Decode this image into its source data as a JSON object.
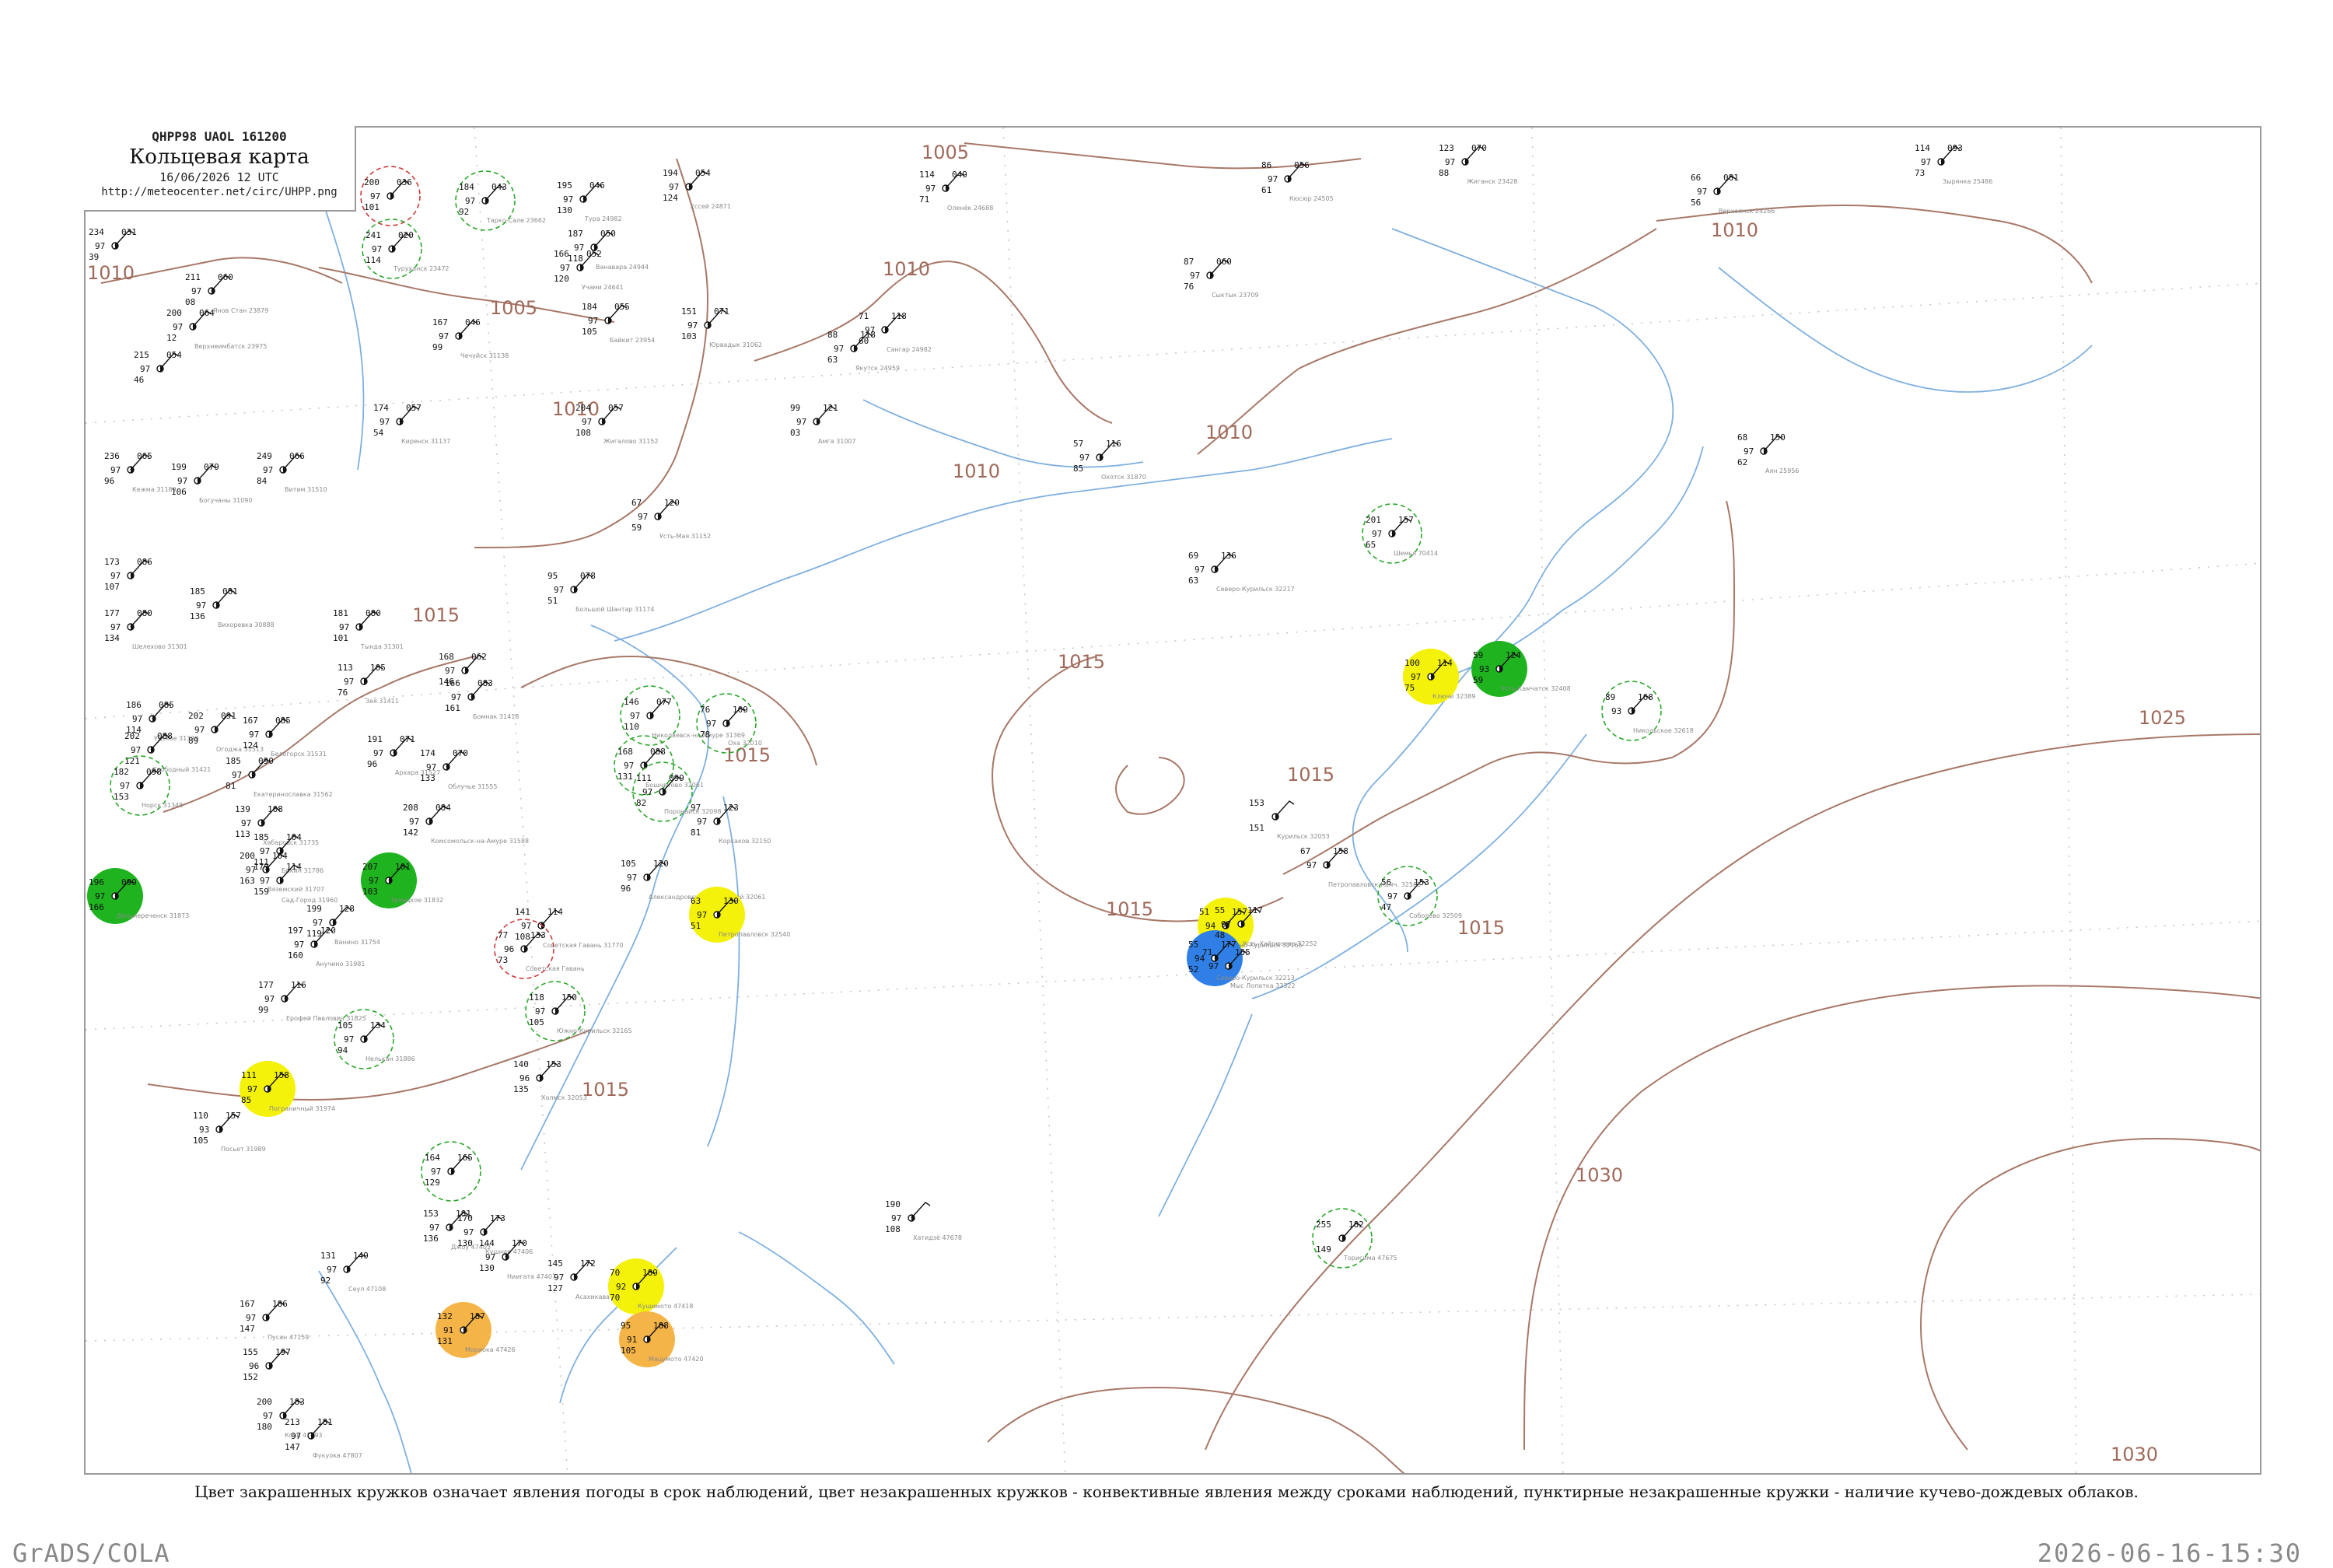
{
  "header": {
    "code_line": "QHPP98  UAOL  161200",
    "title": "Кольцевая карта",
    "date_line": "16/06/2026 12 UTC",
    "url": "http://meteocenter.net/circ/UHPP.png"
  },
  "legend_note": "Цвет закрашенных кружков означает явления погоды в срок наблюдений, цвет незакрашенных кружков - конвективные явления между сроками наблюдений, пунктирные незакрашенные кружки - наличие кучево-дождевых облаков.",
  "footer": {
    "left": "GrADS/COLA",
    "right": "2026-06-16-15:30"
  },
  "colors": {
    "isobar": "#a87868",
    "coast": "#7fb0e0",
    "grid": "#bdbdbd",
    "station": "#111111",
    "green_fill": "#1fb31f",
    "yellow_fill": "#f4f20a",
    "blue_fill": "#2f7fe6",
    "orange_fill": "#f5b447",
    "green_ring": "#2aa82a",
    "red_ring": "#cc3a3a"
  },
  "isobar_labels": [
    {
      "text": "1005"
    },
    {
      "text": "1005"
    },
    {
      "text": "1010"
    },
    {
      "text": "1010"
    },
    {
      "text": "1010"
    },
    {
      "text": "1010"
    },
    {
      "text": "1010"
    },
    {
      "text": "1010"
    },
    {
      "text": "1015"
    },
    {
      "text": "1015"
    },
    {
      "text": "1015"
    },
    {
      "text": "1015"
    },
    {
      "text": "1015"
    },
    {
      "text": "1015"
    },
    {
      "text": "1015"
    },
    {
      "text": "1025"
    },
    {
      "text": "1030"
    },
    {
      "text": "1030"
    }
  ],
  "stations": [
    {
      "t": "200",
      "p": "036",
      "d": "97",
      "w": "101",
      "name": ""
    },
    {
      "t": "241",
      "p": "020",
      "d": "97",
      "w": "114",
      "name": "Туруханск 23472"
    },
    {
      "t": "184",
      "p": "043",
      "d": "97",
      "w": "92",
      "name": "Тарко-Сале 23662"
    },
    {
      "t": "195",
      "p": "046",
      "d": "97",
      "w": "130",
      "name": "Тура 24982"
    },
    {
      "t": "194",
      "p": "054",
      "d": "97",
      "w": "124",
      "name": "Ессей 24871"
    },
    {
      "t": "211",
      "p": "060",
      "d": "97",
      "w": "08",
      "name": "Янов Стан 23879"
    },
    {
      "t": "200",
      "p": "064",
      "d": "97",
      "w": "12",
      "name": "Верхнеимбатск 23975"
    },
    {
      "t": "215",
      "p": "054",
      "d": "97",
      "w": "46",
      "name": ""
    },
    {
      "t": "234",
      "p": "031",
      "d": "97",
      "w": "39",
      "name": ""
    },
    {
      "t": "187",
      "p": "050",
      "d": "97",
      "w": "118",
      "name": "Ванавара 24944"
    },
    {
      "t": "166",
      "p": "052",
      "d": "97",
      "w": "120",
      "name": "Учами 24641"
    },
    {
      "t": "184",
      "p": "055",
      "d": "97",
      "w": "105",
      "name": "Байкит 23954"
    },
    {
      "t": "151",
      "p": "071",
      "d": "97",
      "w": "103",
      "name": "Юрвадык 31062"
    },
    {
      "t": "167",
      "p": "046",
      "d": "97",
      "w": "99",
      "name": "Чечуйск 31138"
    },
    {
      "t": "174",
      "p": "057",
      "d": "97",
      "w": "54",
      "name": "Киренск 31137"
    },
    {
      "t": "204",
      "p": "057",
      "d": "97",
      "w": "108",
      "name": "Жигалово 31152"
    },
    {
      "t": "236",
      "p": "065",
      "d": "97",
      "w": "96",
      "name": "Кежма 31189"
    },
    {
      "t": "199",
      "p": "079",
      "d": "97",
      "w": "106",
      "name": "Богучаны 31090"
    },
    {
      "t": "249",
      "p": "066",
      "d": "97",
      "w": "84",
      "name": "Витим 31510"
    },
    {
      "t": "114",
      "p": "049",
      "d": "97",
      "w": "71",
      "name": "Оленёк 24688"
    },
    {
      "t": "86",
      "p": "056",
      "d": "97",
      "w": "61",
      "name": "Кюсюр 24505"
    },
    {
      "t": "123",
      "p": "070",
      "d": "97",
      "w": "88",
      "name": "Жиганск 23428"
    },
    {
      "t": "114",
      "p": "093",
      "d": "97",
      "w": "73",
      "name": "Зырянка 25486"
    },
    {
      "t": "66",
      "p": "081",
      "d": "97",
      "w": "56",
      "name": "Верхоянск 24266"
    },
    {
      "t": "71",
      "p": "118",
      "d": "97",
      "w": "60",
      "name": "Сангар 24982"
    },
    {
      "t": "88",
      "p": "118",
      "d": "97",
      "w": "63",
      "name": "Якутск 24959"
    },
    {
      "t": "99",
      "p": "121",
      "d": "97",
      "w": "03",
      "name": "Амга 31007"
    },
    {
      "t": "87",
      "p": "060",
      "d": "97",
      "w": "76",
      "name": "Сыктык 23709"
    },
    {
      "t": "57",
      "p": "116",
      "d": "97",
      "w": "85",
      "name": "Охотск 31870"
    },
    {
      "t": "68",
      "p": "150",
      "d": "97",
      "w": "62",
      "name": "Аян 25956"
    },
    {
      "t": "67",
      "p": "120",
      "d": "97",
      "w": "59",
      "name": "Усть-Мая 31152"
    },
    {
      "t": "95",
      "p": "078",
      "d": "97",
      "w": "51",
      "name": "Большой Шантар 31174"
    },
    {
      "t": "173",
      "p": "086",
      "d": "97",
      "w": "107",
      "name": ""
    },
    {
      "t": "177",
      "p": "080",
      "d": "97",
      "w": "134",
      "name": "Шелехово 31301"
    },
    {
      "t": "185",
      "p": "081",
      "d": "97",
      "w": "136",
      "name": "Вихоревка 30888"
    },
    {
      "t": "181",
      "p": "080",
      "d": "97",
      "w": "101",
      "name": "Тындa 31301"
    },
    {
      "t": "113",
      "p": "105",
      "d": "97",
      "w": "76",
      "name": "Зея 31411"
    },
    {
      "t": "168",
      "p": "062",
      "d": "97",
      "w": "146",
      "name": ""
    },
    {
      "t": "166",
      "p": "083",
      "d": "97",
      "w": "161",
      "name": "Бомнак 31418"
    },
    {
      "t": "186",
      "p": "085",
      "d": "97",
      "w": "114",
      "name": "Удское 31329"
    },
    {
      "t": "202",
      "p": "088",
      "d": "97",
      "w": "121",
      "name": "Свободный 31421"
    },
    {
      "t": "202",
      "p": "091",
      "d": "97",
      "w": "89",
      "name": "Огоджа 31513"
    },
    {
      "t": "167",
      "p": "085",
      "d": "97",
      "w": "124",
      "name": "Белогорск 31531"
    },
    {
      "t": "182",
      "p": "098",
      "d": "97",
      "w": "153",
      "name": "Норск 31348"
    },
    {
      "t": "185",
      "p": "090",
      "d": "97",
      "w": "81",
      "name": "Екатеринославка 31562"
    },
    {
      "t": "191",
      "p": "071",
      "d": "97",
      "w": "96",
      "name": "Архара 31527"
    },
    {
      "t": "174",
      "p": "070",
      "d": "97",
      "w": "133",
      "name": "Облучье 31555"
    },
    {
      "t": "208",
      "p": "084",
      "d": "97",
      "w": "142",
      "name": "Комсомольск-на-Амуре 31588"
    },
    {
      "t": "146",
      "p": "077",
      "d": "97",
      "w": "110",
      "name": "Николаевск-на-Амуре 31369"
    },
    {
      "t": "76",
      "p": "109",
      "d": "97",
      "w": "78",
      "name": "Оха 32010"
    },
    {
      "t": "168",
      "p": "088",
      "d": "97",
      "w": "131",
      "name": "Бошняково 32061"
    },
    {
      "t": "111",
      "p": "099",
      "d": "97",
      "w": "82",
      "name": "Поронайск 32098"
    },
    {
      "t": "97",
      "p": "123",
      "d": "97",
      "w": "81",
      "name": "Корсаков 32150"
    },
    {
      "t": "139",
      "p": "108",
      "d": "97",
      "w": "113",
      "name": "Хабаровск 31735"
    },
    {
      "t": "185",
      "p": "104",
      "d": "97",
      "w": "111",
      "name": "Бикин 31786"
    },
    {
      "t": "200",
      "p": "104",
      "d": "97",
      "w": "163",
      "name": "Вяземский 31707"
    },
    {
      "t": "179",
      "p": "114",
      "d": "97",
      "w": "159",
      "name": "Сад-Город 31960"
    },
    {
      "t": "196",
      "p": "099",
      "d": "97",
      "w": "166",
      "name": "Дальнереченск 31873"
    },
    {
      "t": "207",
      "p": "101",
      "d": "97",
      "w": "103",
      "name": "Троицкое 31832"
    },
    {
      "t": "199",
      "p": "128",
      "d": "97",
      "w": "119",
      "name": "Ванино 31754"
    },
    {
      "t": "197",
      "p": "120",
      "d": "97",
      "w": "160",
      "name": "Анучино 31981"
    },
    {
      "t": "105",
      "p": "120",
      "d": "97",
      "w": "96",
      "name": "Александровск-Сахалинский 32061"
    },
    {
      "t": "63",
      "p": "130",
      "d": "97",
      "w": "51",
      "name": "Петропавловск 32540"
    },
    {
      "t": "141",
      "p": "114",
      "d": "97",
      "w": "108",
      "name": "Советская Гавань 31770"
    },
    {
      "t": "77",
      "p": "133",
      "d": "96",
      "w": "73",
      "name": "Советская Гавань"
    },
    {
      "t": "177",
      "p": "116",
      "d": "97",
      "w": "99",
      "name": "Ерофей Павлович 31825"
    },
    {
      "t": "118",
      "p": "150",
      "d": "97",
      "w": "105",
      "name": "Южно-Курильск 32165"
    },
    {
      "t": "140",
      "p": "153",
      "d": "96",
      "w": "135",
      "name": "Холмск 32053"
    },
    {
      "t": "105",
      "p": "134",
      "d": "97",
      "w": "94",
      "name": "Нелькан 31886"
    },
    {
      "t": "111",
      "p": "158",
      "d": "97",
      "w": "85",
      "name": "Пограничный 31974"
    },
    {
      "t": "110",
      "p": "157",
      "d": "93",
      "w": "105",
      "name": "Посьет 31989"
    },
    {
      "t": "164",
      "p": "165",
      "d": "97",
      "w": "129",
      "name": ""
    },
    {
      "t": "153",
      "p": "181",
      "d": "97",
      "w": "136",
      "name": "Джоу 47403"
    },
    {
      "t": "170",
      "p": "173",
      "d": "97",
      "w": "130",
      "name": "Кушнир 47406"
    },
    {
      "t": "144",
      "p": "170",
      "d": "97",
      "w": "130",
      "name": "Ниигата 47407"
    },
    {
      "t": "145",
      "p": "172",
      "d": "97",
      "w": "127",
      "name": "Асахикава 47412"
    },
    {
      "t": "70",
      "p": "189",
      "d": "92",
      "w": "70",
      "name": "Кушимото 47418"
    },
    {
      "t": "95",
      "p": "188",
      "d": "91",
      "w": "105",
      "name": "Мацумото 47420"
    },
    {
      "t": "132",
      "p": "187",
      "d": "91",
      "w": "131",
      "name": "Мориока 47426"
    },
    {
      "t": "131",
      "p": "149",
      "d": "97",
      "w": "92",
      "name": "Сеул 47108"
    },
    {
      "t": "167",
      "p": "186",
      "d": "97",
      "w": "147",
      "name": "Пусан 47159"
    },
    {
      "t": "155",
      "p": "197",
      "d": "96",
      "w": "152",
      "name": ""
    },
    {
      "t": "200",
      "p": "183",
      "d": "97",
      "w": "180",
      "name": "Кочи 47893"
    },
    {
      "t": "213",
      "p": "181",
      "d": "97",
      "w": "147",
      "name": "Фукуока 47807"
    },
    {
      "t": "190",
      "p": "",
      "d": "97",
      "w": "108",
      "name": "Хатидзё 47678"
    },
    {
      "t": "255",
      "p": "182",
      "d": "",
      "w": "149",
      "name": "Торисима 47675"
    },
    {
      "t": "69",
      "p": "136",
      "d": "97",
      "w": "63",
      "name": "Северо-Курильск 32217"
    },
    {
      "t": "100",
      "p": "114",
      "d": "97",
      "w": "75",
      "name": "Ключи 32389"
    },
    {
      "t": "59",
      "p": "124",
      "d": "93",
      "w": "59",
      "name": "Усть-Камчатск 32408"
    },
    {
      "t": "89",
      "p": "168",
      "d": "93",
      "w": "",
      "name": "Никольское 32618"
    },
    {
      "t": "56",
      "p": "153",
      "d": "97",
      "w": "47",
      "name": "Соболево 32509"
    },
    {
      "t": "153",
      "p": "",
      "d": "",
      "w": "151",
      "name": "Курильск 32053"
    },
    {
      "t": "67",
      "p": "158",
      "d": "97",
      "w": "",
      "name": "Петропавловск-Камч. 32583"
    },
    {
      "t": "51",
      "p": "157",
      "d": "94",
      "w": "",
      "name": "Южно-Курильск 32165"
    },
    {
      "t": "55",
      "p": "177",
      "d": "94",
      "w": "52",
      "name": "Северо-Курильск 32213"
    },
    {
      "t": "71",
      "p": "155",
      "d": "97",
      "w": "",
      "name": "Мыс Лопатка 32322"
    },
    {
      "t": "55",
      "p": "117",
      "d": "97",
      "w": "48",
      "name": "Усть-Хайрюзово 32252"
    },
    {
      "t": "201",
      "p": "157",
      "d": "97",
      "w": "65",
      "name": "Шемья 70414"
    }
  ]
}
